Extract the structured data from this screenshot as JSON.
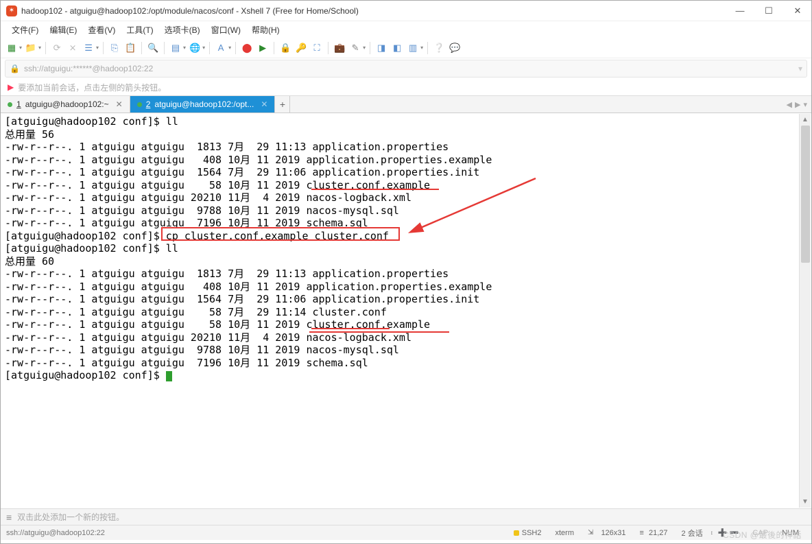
{
  "window": {
    "title": "hadoop102 - atguigu@hadoop102:/opt/module/nacos/conf - Xshell 7 (Free for Home/School)"
  },
  "menu": {
    "file": "文件(F)",
    "edit": "编辑(E)",
    "view": "查看(V)",
    "tools": "工具(T)",
    "tabs": "选项卡(B)",
    "window": "窗口(W)",
    "help": "帮助(H)"
  },
  "address": {
    "text": "ssh://atguigu:******@hadoop102:22"
  },
  "hint": {
    "text": "要添加当前会话，点击左侧的箭头按钮。"
  },
  "tabs": {
    "t1": {
      "num": "1",
      "label": "atguigu@hadoop102:~"
    },
    "t2": {
      "num": "2",
      "label": "atguigu@hadoop102:/opt..."
    }
  },
  "terminal": {
    "lines": [
      "[atguigu@hadoop102 conf]$ ll",
      "总用量 56",
      "-rw-r--r--. 1 atguigu atguigu  1813 7月  29 11:13 application.properties",
      "-rw-r--r--. 1 atguigu atguigu   408 10月 11 2019 application.properties.example",
      "-rw-r--r--. 1 atguigu atguigu  1564 7月  29 11:06 application.properties.init",
      "-rw-r--r--. 1 atguigu atguigu    58 10月 11 2019 cluster.conf.example",
      "-rw-r--r--. 1 atguigu atguigu 20210 11月  4 2019 nacos-logback.xml",
      "-rw-r--r--. 1 atguigu atguigu  9788 10月 11 2019 nacos-mysql.sql",
      "-rw-r--r--. 1 atguigu atguigu  7196 10月 11 2019 schema.sql",
      "[atguigu@hadoop102 conf]$ cp cluster.conf.example cluster.conf",
      "[atguigu@hadoop102 conf]$ ll",
      "总用量 60",
      "-rw-r--r--. 1 atguigu atguigu  1813 7月  29 11:13 application.properties",
      "-rw-r--r--. 1 atguigu atguigu   408 10月 11 2019 application.properties.example",
      "-rw-r--r--. 1 atguigu atguigu  1564 7月  29 11:06 application.properties.init",
      "-rw-r--r--. 1 atguigu atguigu    58 7月  29 11:14 cluster.conf",
      "-rw-r--r--. 1 atguigu atguigu    58 10月 11 2019 cluster.conf.example",
      "-rw-r--r--. 1 atguigu atguigu 20210 11月  4 2019 nacos-logback.xml",
      "-rw-r--r--. 1 atguigu atguigu  9788 10月 11 2019 nacos-mysql.sql",
      "-rw-r--r--. 1 atguigu atguigu  7196 10月 11 2019 schema.sql",
      "[atguigu@hadoop102 conf]$ "
    ]
  },
  "bottomtab": {
    "hint": "双击此处添加一个新的按钮。"
  },
  "status": {
    "left": "ssh://atguigu@hadoop102:22",
    "ssh": "SSH2",
    "term": "xterm",
    "size": "126x31",
    "pos": "21,27",
    "sessions": "2 会话",
    "cap": "CAP",
    "num": "NUM"
  },
  "watermark": "CSDN @最後的神話"
}
